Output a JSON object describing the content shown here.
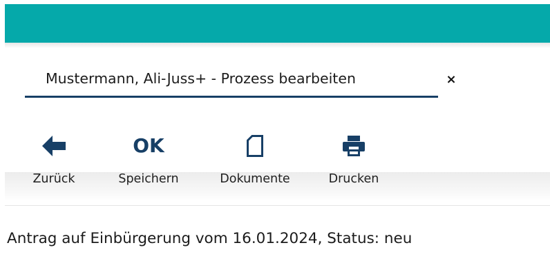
{
  "colors": {
    "header": "#05a9aa",
    "accent": "#173f66"
  },
  "tab": {
    "title": "Mustermann, Ali-Juss+ - Prozess bearbeiten",
    "close_icon": "close-icon",
    "close_glyph": "×"
  },
  "toolbar": {
    "back": {
      "label": "Zurück",
      "icon": "arrow-left-icon"
    },
    "save": {
      "label": "Speichern",
      "icon": "ok-icon",
      "icon_text": "OK"
    },
    "docs": {
      "label": "Dokumente",
      "icon": "document-icon"
    },
    "print": {
      "label": "Drucken",
      "icon": "printer-icon"
    }
  },
  "main": {
    "status_text": "Antrag auf Einbürgerung vom 16.01.2024, Status: neu"
  }
}
